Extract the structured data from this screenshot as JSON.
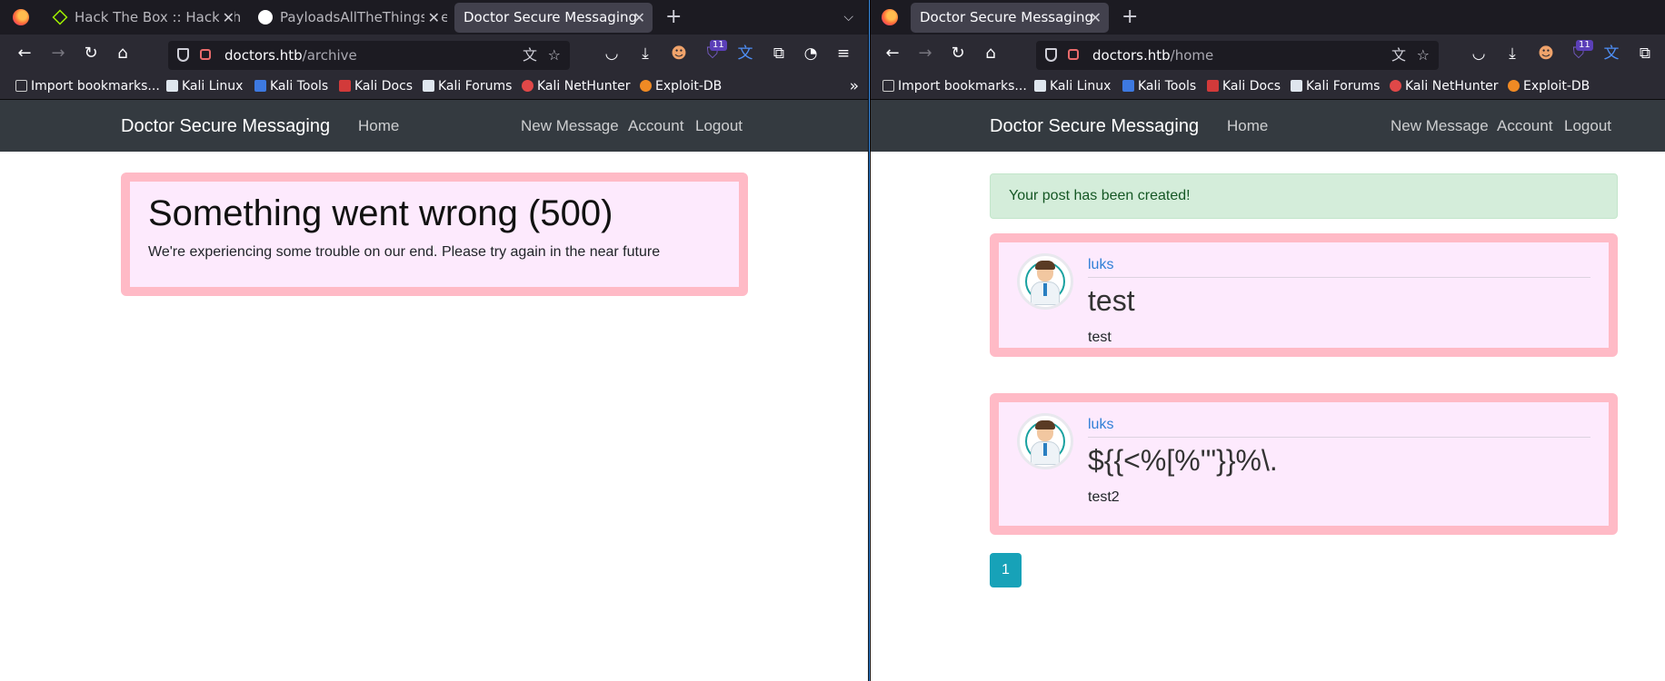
{
  "left": {
    "tabs": [
      {
        "label": "Hack The Box :: Hack The",
        "favicon": "htb-cube-icon"
      },
      {
        "label": "PayloadsAllTheThings/Se",
        "favicon": "github-icon"
      },
      {
        "label": "Doctor Secure Messaging",
        "favicon": "",
        "active": true
      }
    ],
    "url_host": "doctors.htb",
    "url_path": "/archive",
    "error": {
      "title": "Something went wrong (500)",
      "text": "We're experiencing some trouble on our end. Please try again in the near future"
    }
  },
  "right": {
    "tabs": [
      {
        "label": "Doctor Secure Messaging",
        "active": true
      }
    ],
    "url_host": "doctors.htb",
    "url_path": "/home",
    "alert": "Your post has been created!",
    "posts": [
      {
        "author": "luks",
        "title": "test",
        "body": "test"
      },
      {
        "author": "luks",
        "title": "${{<%[%'\"}}%\\.",
        "body": "test2"
      }
    ],
    "pagination": [
      "1"
    ]
  },
  "browser": {
    "badge_count": "11",
    "bookmarks": [
      "Import bookmarks...",
      "Kali Linux",
      "Kali Tools",
      "Kali Docs",
      "Kali Forums",
      "Kali NetHunter",
      "Exploit-DB"
    ]
  },
  "site": {
    "brand": "Doctor Secure Messaging",
    "nav": {
      "home": "Home",
      "new_message": "New Message",
      "account": "Account",
      "logout": "Logout"
    }
  },
  "colors": {
    "navbar": "#343a40",
    "card_border": "#ffbac6",
    "card_bg": "#fdeafd",
    "alert_bg": "#d4edda",
    "pager": "#17a2b8",
    "link": "#2f7fd6"
  }
}
